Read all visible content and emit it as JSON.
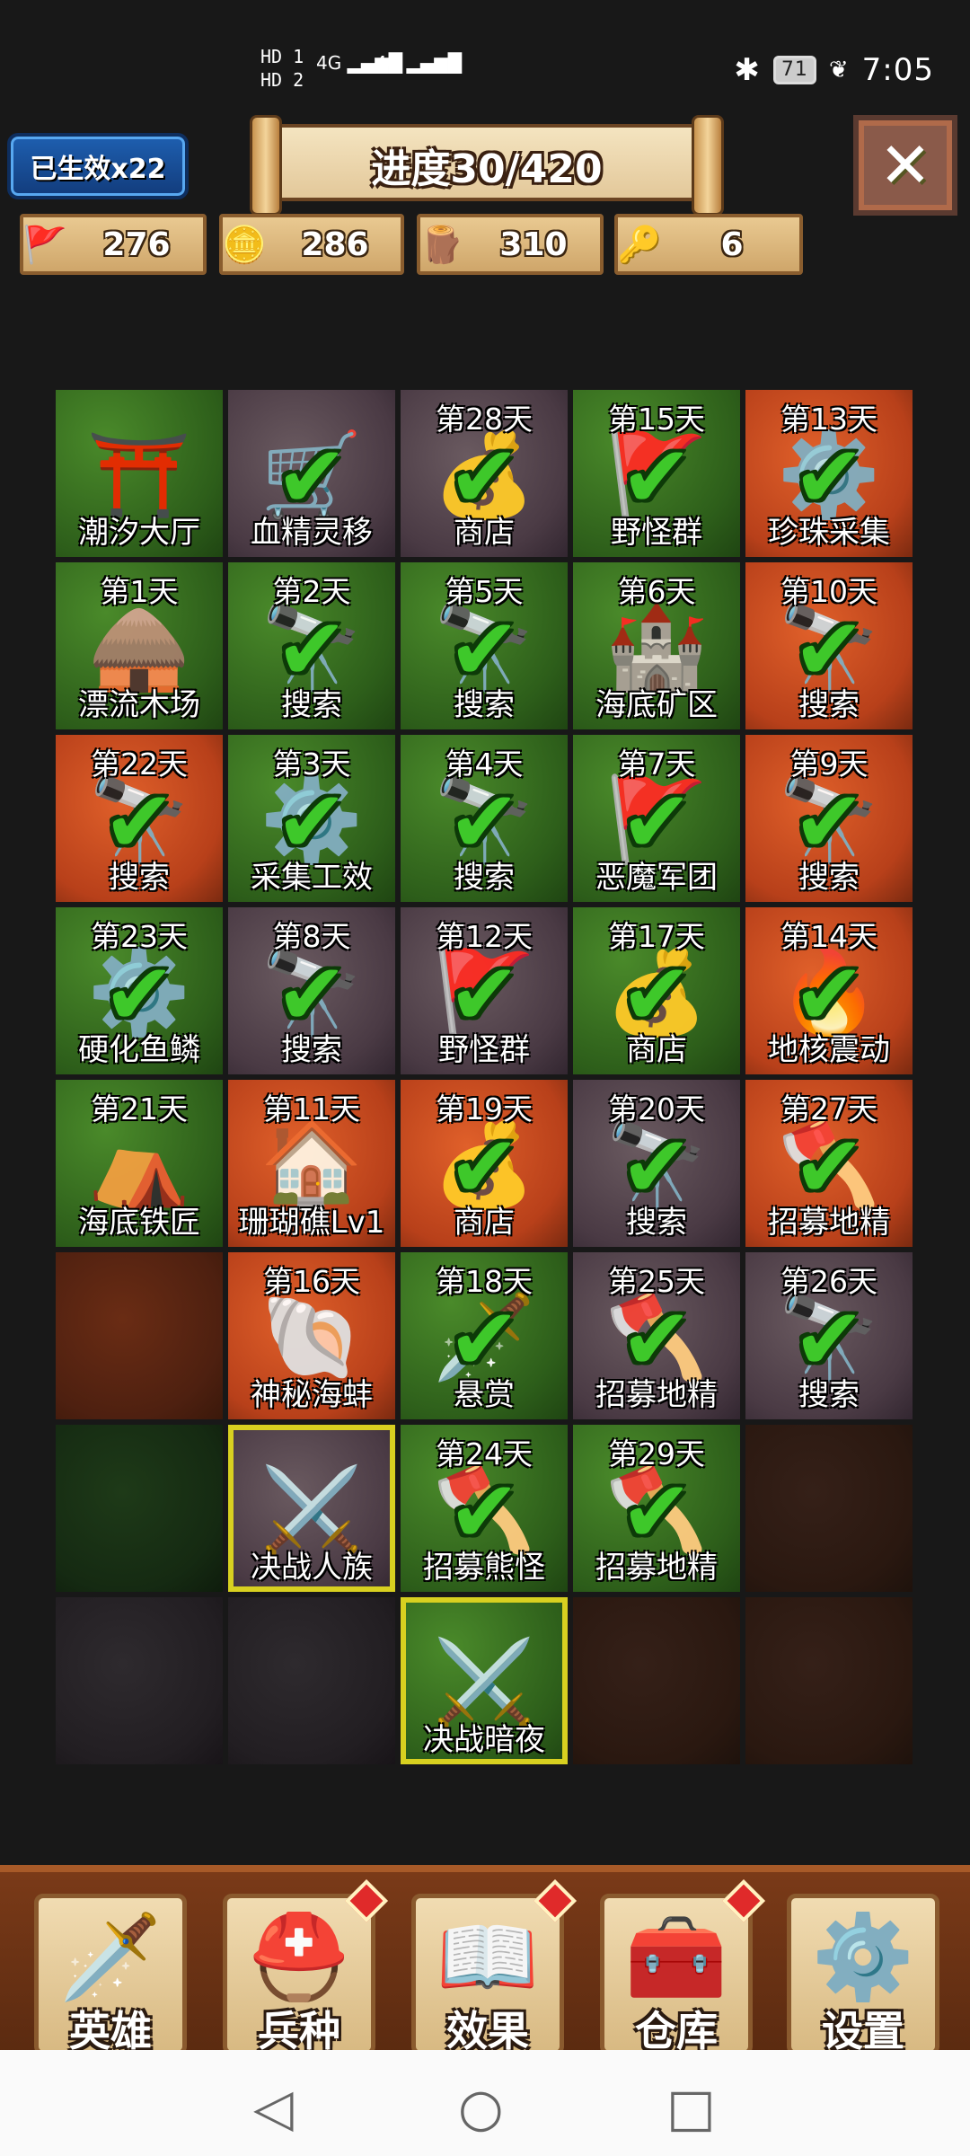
{
  "status_bar": {
    "hd1": "HD 1",
    "hd2": "HD 2",
    "net1": "4G",
    "net2": "4G",
    "battery": "71",
    "time": "7:05"
  },
  "header": {
    "effect_badge": "已生效x22",
    "progress_title": "进度30/420",
    "close_icon": "close-icon"
  },
  "resources": [
    {
      "icon": "population-icon",
      "value": "276"
    },
    {
      "icon": "gold-coins-icon",
      "value": "286"
    },
    {
      "icon": "wood-logs-icon",
      "value": "310"
    },
    {
      "icon": "crystal-key-icon",
      "value": "6"
    }
  ],
  "grid": [
    [
      {
        "day": "",
        "name": "潮汐大厅",
        "bg": "green",
        "art": "pavilion-icon",
        "done": false
      },
      {
        "day": "",
        "name": "血精灵移",
        "bg": "stone",
        "art": "wagon-icon",
        "done": true
      },
      {
        "day": "第28天",
        "name": "商店",
        "bg": "stone",
        "art": "treasure-icon",
        "done": true
      },
      {
        "day": "第15天",
        "name": "野怪群",
        "bg": "green",
        "art": "banner-icon",
        "done": true
      },
      {
        "day": "第13天",
        "name": "珍珠采集",
        "bg": "lava",
        "art": "gear-icon",
        "done": true
      }
    ],
    [
      {
        "day": "第1天",
        "name": "漂流木场",
        "bg": "green",
        "art": "lumber-hut-icon",
        "done": false
      },
      {
        "day": "第2天",
        "name": "搜索",
        "bg": "green",
        "art": "spyglass-icon",
        "done": true
      },
      {
        "day": "第5天",
        "name": "搜索",
        "bg": "green",
        "art": "spyglass-icon",
        "done": true
      },
      {
        "day": "第6天",
        "name": "海底矿区",
        "bg": "green",
        "art": "mine-icon",
        "done": false
      },
      {
        "day": "第10天",
        "name": "搜索",
        "bg": "lava",
        "art": "spyglass-icon",
        "done": true
      }
    ],
    [
      {
        "day": "第22天",
        "name": "搜索",
        "bg": "lava",
        "art": "spyglass-icon",
        "done": true
      },
      {
        "day": "第3天",
        "name": "采集工效",
        "bg": "green",
        "art": "gear-icon",
        "done": true
      },
      {
        "day": "第4天",
        "name": "搜索",
        "bg": "green",
        "art": "spyglass-icon",
        "done": true
      },
      {
        "day": "第7天",
        "name": "恶魔军团",
        "bg": "green",
        "art": "banner-icon",
        "done": true
      },
      {
        "day": "第9天",
        "name": "搜索",
        "bg": "lava",
        "art": "spyglass-icon",
        "done": true
      }
    ],
    [
      {
        "day": "第23天",
        "name": "硬化鱼鳞",
        "bg": "green",
        "art": "gear-icon",
        "done": true
      },
      {
        "day": "第8天",
        "name": "搜索",
        "bg": "stone",
        "art": "spyglass-icon",
        "done": true
      },
      {
        "day": "第12天",
        "name": "野怪群",
        "bg": "stone",
        "art": "banner-icon",
        "done": true
      },
      {
        "day": "第17天",
        "name": "商店",
        "bg": "green",
        "art": "treasure-icon",
        "done": true
      },
      {
        "day": "第14天",
        "name": "地核震动",
        "bg": "lava",
        "art": "fire-icon",
        "done": true
      }
    ],
    [
      {
        "day": "第21天",
        "name": "海底铁匠",
        "bg": "green",
        "art": "forge-icon",
        "done": false
      },
      {
        "day": "第11天",
        "name": "珊瑚礁Lv1",
        "bg": "lava",
        "art": "coral-house-icon",
        "done": false
      },
      {
        "day": "第19天",
        "name": "商店",
        "bg": "lava",
        "art": "treasure-icon",
        "done": true
      },
      {
        "day": "第20天",
        "name": "搜索",
        "bg": "stone",
        "art": "spyglass-icon",
        "done": true
      },
      {
        "day": "第27天",
        "name": "招募地精",
        "bg": "lava",
        "art": "axes-icon",
        "done": true
      }
    ],
    [
      {
        "day": "",
        "name": "",
        "bg": "dirt",
        "art": "",
        "done": false
      },
      {
        "day": "第16天",
        "name": "神秘海蚌",
        "bg": "lava",
        "art": "clam-icon",
        "done": false
      },
      {
        "day": "第18天",
        "name": "悬赏",
        "bg": "green",
        "art": "dagger-icon",
        "done": true
      },
      {
        "day": "第25天",
        "name": "招募地精",
        "bg": "stone",
        "art": "axes-icon",
        "done": true
      },
      {
        "day": "第26天",
        "name": "搜索",
        "bg": "stone",
        "art": "spyglass-icon",
        "done": true
      }
    ],
    [
      {
        "day": "",
        "name": "",
        "bg": "dark",
        "art": "",
        "done": false
      },
      {
        "day": "",
        "name": "决战人族",
        "bg": "stone",
        "art": "crossed-swords-icon",
        "done": false,
        "selected": true
      },
      {
        "day": "第24天",
        "name": "招募熊怪",
        "bg": "green",
        "art": "axes-icon",
        "done": true
      },
      {
        "day": "第29天",
        "name": "招募地精",
        "bg": "green",
        "art": "axes-icon",
        "done": true
      },
      {
        "day": "",
        "name": "",
        "bg": "darkdirt",
        "art": "",
        "done": false
      }
    ],
    [
      {
        "day": "",
        "name": "",
        "bg": "rock",
        "art": "",
        "done": false
      },
      {
        "day": "",
        "name": "",
        "bg": "rock",
        "art": "",
        "done": false
      },
      {
        "day": "",
        "name": "决战暗夜",
        "bg": "green",
        "art": "crossed-swords-icon",
        "done": false,
        "selected": true
      },
      {
        "day": "",
        "name": "",
        "bg": "darkdirt",
        "art": "",
        "done": false
      },
      {
        "day": "",
        "name": "",
        "bg": "darkdirt",
        "art": "",
        "done": false
      }
    ]
  ],
  "bottom_nav": [
    {
      "label": "英雄",
      "icon": "sword-icon",
      "notify": false
    },
    {
      "label": "兵种",
      "icon": "helmet-icon",
      "notify": true
    },
    {
      "label": "效果",
      "icon": "spellbook-icon",
      "notify": true
    },
    {
      "label": "仓库",
      "icon": "chest-icon",
      "notify": true
    },
    {
      "label": "设置",
      "icon": "gear-icon",
      "notify": false
    }
  ],
  "system_nav": {
    "back": "back-icon",
    "home": "home-icon",
    "recent": "recent-apps-icon"
  },
  "colors": {
    "selected_outline": "#d8d020",
    "check_green": "#3ec82a",
    "nav_bg": "#6a3214",
    "badge_blue": "#1e5fb0"
  }
}
